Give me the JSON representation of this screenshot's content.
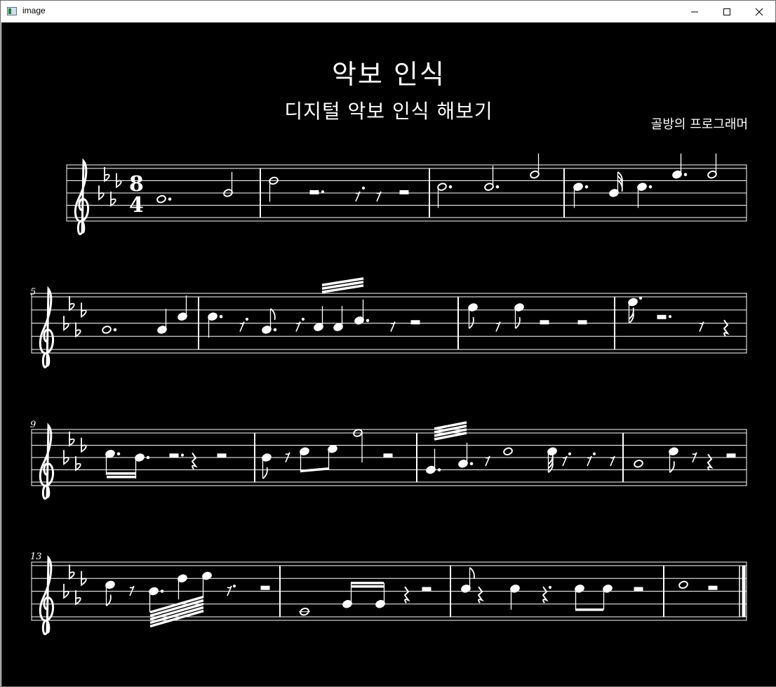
{
  "window": {
    "title": "image",
    "controls": [
      "minimize",
      "maximize",
      "close"
    ]
  },
  "sheet": {
    "title": "악보 인식",
    "subtitle": "디지털 악보 인식 해보기",
    "composer": "골방의 프로그래머",
    "time_signature": {
      "top": "8",
      "bottom": "4"
    },
    "key_signature": "four-flats",
    "systems": [
      {
        "start_measure": "",
        "barlines": 4
      },
      {
        "start_measure": "5",
        "barlines": 4
      },
      {
        "start_measure": "9",
        "barlines": 4
      },
      {
        "start_measure": "13",
        "barlines": 4
      }
    ]
  },
  "colors": {
    "background": "#000000",
    "ink": "#ffffff",
    "titlebar": "#ffffff"
  }
}
